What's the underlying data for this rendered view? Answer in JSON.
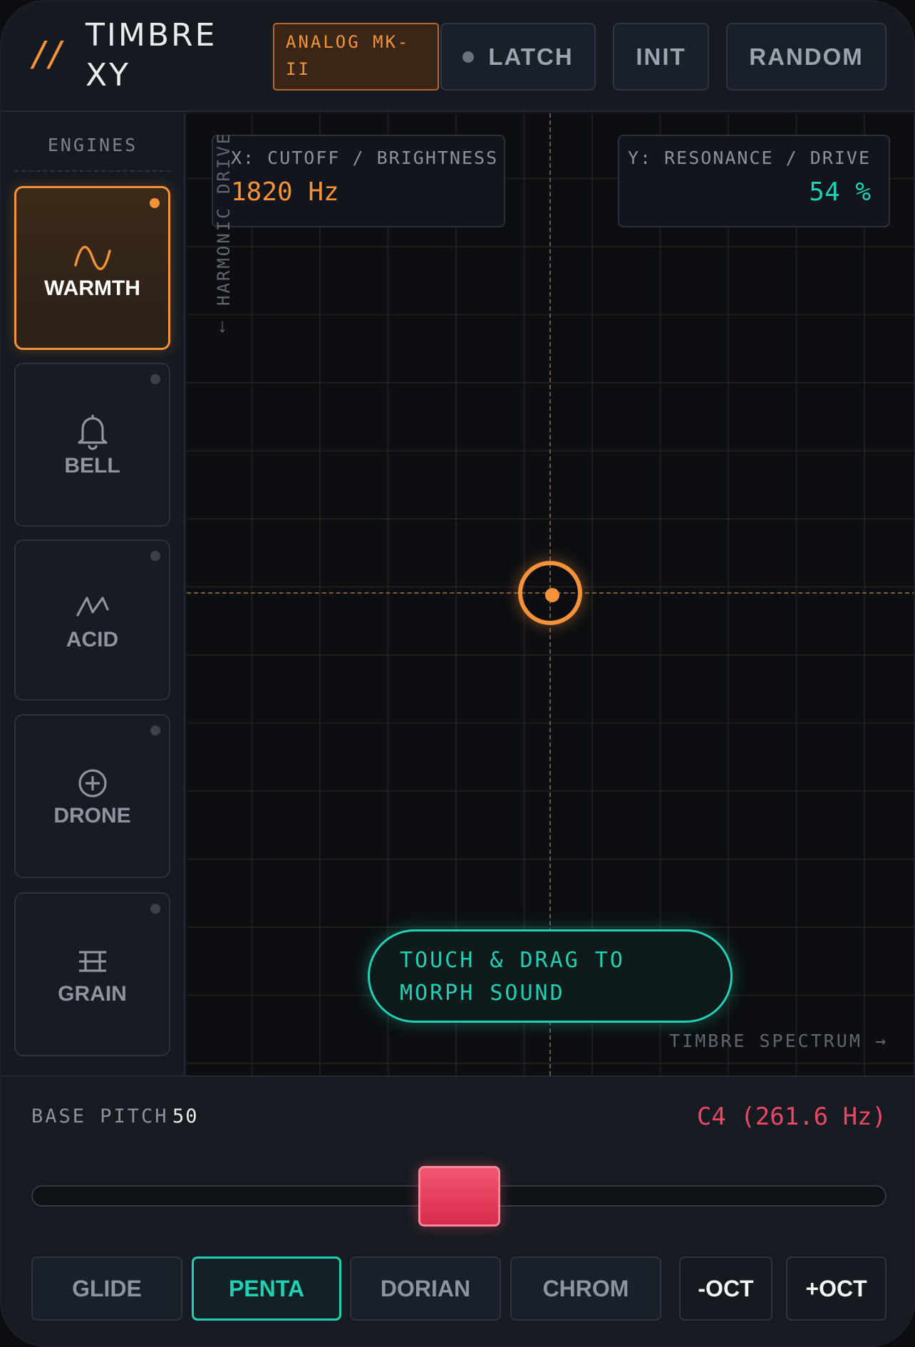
{
  "header": {
    "logo_mark": "//",
    "title": "TIMBRE XY",
    "preset": "ANALOG MK-II",
    "buttons": {
      "latch": "LATCH",
      "init": "INIT",
      "random": "RANDOM"
    }
  },
  "sidebar": {
    "title": "ENGINES",
    "engines": [
      {
        "label": "WARMTH",
        "icon": "sine-wave-icon",
        "active": true
      },
      {
        "label": "BELL",
        "icon": "bell-icon",
        "active": false
      },
      {
        "label": "ACID",
        "icon": "sawtooth-wave-icon",
        "active": false
      },
      {
        "label": "DRONE",
        "icon": "plus-circle-icon",
        "active": false
      },
      {
        "label": "GRAIN",
        "icon": "grain-icon",
        "active": false
      }
    ]
  },
  "pad": {
    "x_readout": {
      "caption": "X: CUTOFF / BRIGHTNESS",
      "value": "1820 Hz"
    },
    "y_readout": {
      "caption": "Y: RESONANCE / DRIVE",
      "value": "54 %"
    },
    "y_axis_label": "HARMONIC DRIVE",
    "y_axis_arrow": "→",
    "x_axis_label": "TIMBRE SPECTRUM →",
    "hint": "TOUCH & DRAG TO MORPH SOUND"
  },
  "bottom": {
    "pitch_label": "BASE PITCH",
    "pitch_value": "50",
    "note_readout": "C4 (261.6 Hz)",
    "pitch_fraction": 0.5,
    "modes": [
      "GLIDE",
      "PENTA",
      "DORIAN",
      "CHROM"
    ],
    "active_mode": "PENTA",
    "octave_down": "-OCT",
    "octave_up": "+OCT"
  },
  "colors": {
    "accent_orange": "#f5923a",
    "accent_teal": "#21d0b4",
    "accent_pink": "#ec4866",
    "background": "#12161c"
  }
}
